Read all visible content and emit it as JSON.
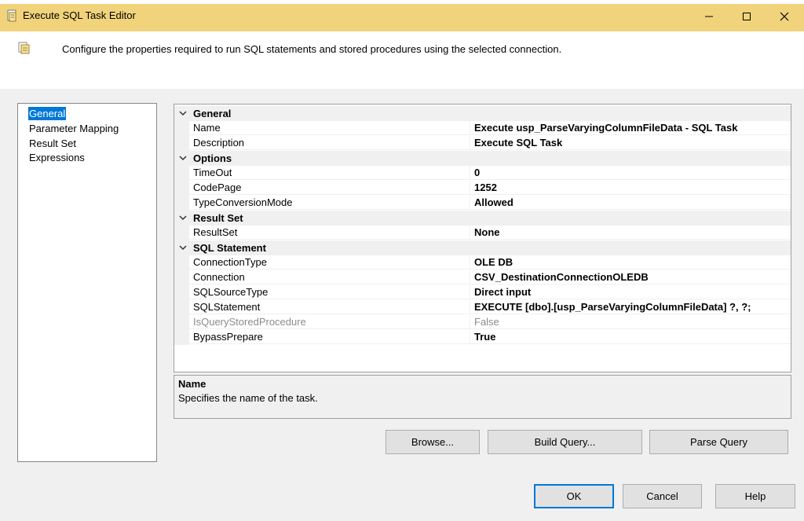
{
  "window": {
    "title": "Execute SQL Task Editor",
    "controls": {
      "minimize": "—",
      "maximize": "☐",
      "close": "✕"
    }
  },
  "header": {
    "description": "Configure the properties required to run SQL statements and stored procedures using the selected connection."
  },
  "nav": {
    "items": [
      {
        "label": "General",
        "selected": true
      },
      {
        "label": "Parameter Mapping",
        "selected": false
      },
      {
        "label": "Result Set",
        "selected": false
      },
      {
        "label": "Expressions",
        "selected": false
      }
    ]
  },
  "properties": {
    "general": {
      "title": "General",
      "rows": [
        {
          "name": "Name",
          "value": "Execute usp_ParseVaryingColumnFileData -  SQL Task"
        },
        {
          "name": "Description",
          "value": "Execute SQL Task"
        }
      ]
    },
    "options": {
      "title": "Options",
      "rows": [
        {
          "name": "TimeOut",
          "value": "0"
        },
        {
          "name": "CodePage",
          "value": "1252"
        },
        {
          "name": "TypeConversionMode",
          "value": "Allowed"
        }
      ]
    },
    "result_set": {
      "title": "Result Set",
      "rows": [
        {
          "name": "ResultSet",
          "value": "None"
        }
      ]
    },
    "sql_statement": {
      "title": "SQL Statement",
      "rows": [
        {
          "name": "ConnectionType",
          "value": "OLE DB"
        },
        {
          "name": "Connection",
          "value": "CSV_DestinationConnectionOLEDB"
        },
        {
          "name": "SQLSourceType",
          "value": "Direct input"
        },
        {
          "name": "SQLStatement",
          "value": "EXECUTE [dbo].[usp_ParseVaryingColumnFileData] ?, ?;"
        },
        {
          "name": "IsQueryStoredProcedure",
          "value": "False"
        },
        {
          "name": "BypassPrepare",
          "value": "True"
        }
      ]
    }
  },
  "description_panel": {
    "title": "Name",
    "text": "Specifies the name of the task."
  },
  "buttons": {
    "browse": "Browse...",
    "build_query": "Build Query...",
    "parse_query": "Parse Query",
    "ok": "OK",
    "cancel": "Cancel",
    "help": "Help"
  },
  "colors": {
    "title_bar": "#f1d37b",
    "selection": "#0078d7"
  }
}
